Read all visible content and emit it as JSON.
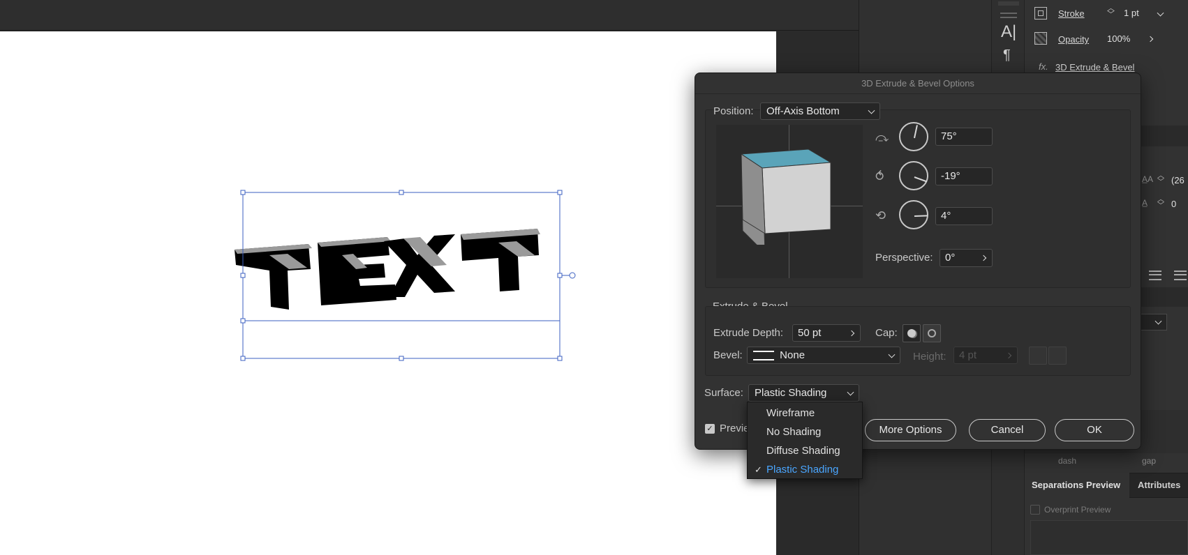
{
  "app": {
    "canvas_text_object": "TEXT"
  },
  "panel": {
    "stroke_label": "Stroke",
    "stroke_value": "1 pt",
    "opacity_label": "Opacity",
    "opacity_value": "100%",
    "effect_label": "3D Extrude & Bevel",
    "fx_icon_text": "fx.",
    "char_value_1": "(26",
    "char_value_2": "0",
    "dash_label": "dash",
    "gap_label": "gap",
    "tab_separations": "Separations Preview",
    "tab_attributes": "Attributes",
    "overprint_label": "Overprint Preview"
  },
  "dialog": {
    "title": "3D Extrude & Bevel Options",
    "position_label": "Position:",
    "position_value": "Off-Axis Bottom",
    "rot_x": "75°",
    "rot_y": "-19°",
    "rot_z": "4°",
    "perspective_label": "Perspective:",
    "perspective_value": "0°",
    "extrude_section": "Extrude & Bevel",
    "extrude_depth_label": "Extrude Depth:",
    "extrude_depth_value": "50 pt",
    "cap_label": "Cap:",
    "bevel_label": "Bevel:",
    "bevel_value": "None",
    "height_label": "Height:",
    "height_value": "4 pt",
    "surface_label": "Surface:",
    "surface_value": "Plastic Shading",
    "preview_label": "Previe",
    "more_options": "More Options",
    "cancel": "Cancel",
    "ok": "OK"
  },
  "surface_menu": {
    "items": [
      "Wireframe",
      "No Shading",
      "Diffuse Shading",
      "Plastic Shading"
    ],
    "selected": "Plastic Shading",
    "check_glyph": "✓"
  },
  "colors": {
    "cube_top": "#5aa4b9",
    "selection": "#3b5fc0",
    "accent_selected": "#4aa6ff"
  }
}
